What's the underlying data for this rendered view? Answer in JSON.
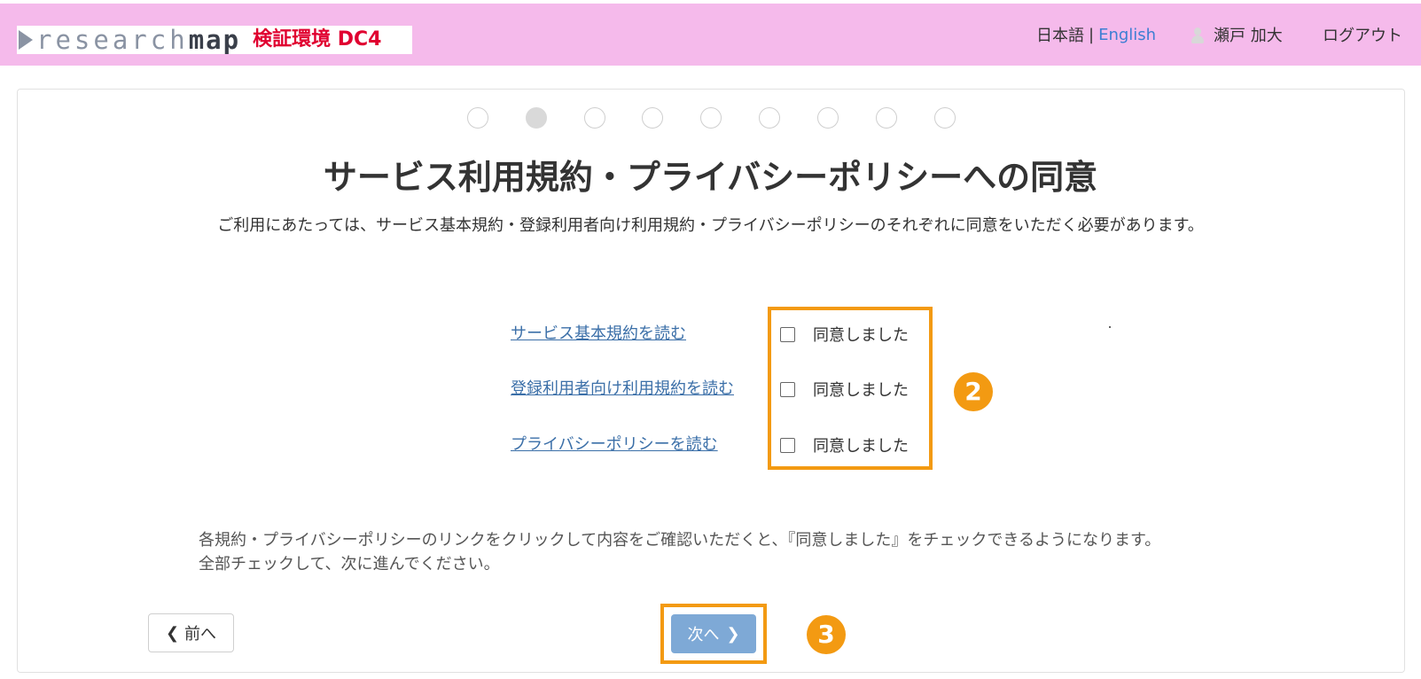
{
  "header": {
    "logo_text_light": "research",
    "logo_text_dark": "map",
    "environment_label": "検証環境 DC4",
    "lang_japanese": "日本語",
    "lang_separator": "|",
    "lang_english": "English",
    "user_icon": "user-icon",
    "user_name": "瀬戸 加大",
    "logout_label": "ログアウト",
    "background_color": "#f5baeb"
  },
  "steps": {
    "total": 9,
    "current": 2
  },
  "main": {
    "title": "サービス利用規約・プライバシーポリシーへの同意",
    "subtitle": "ご利用にあたっては、サービス基本規約・登録利用者向け利用規約・プライバシーポリシーのそれぞれに同意をいただく必要があります。"
  },
  "agreements": [
    {
      "link_label": "サービス基本規約を読む",
      "checkbox_label": "同意しました",
      "checked": false
    },
    {
      "link_label": "登録利用者向け利用規約を読む",
      "checkbox_label": "同意しました",
      "checked": false
    },
    {
      "link_label": "プライバシーポリシーを読む",
      "checkbox_label": "同意しました",
      "checked": false
    }
  ],
  "notice": {
    "line1": "各規約・プライバシーポリシーのリンクをクリックして内容をご確認いただくと、『同意しました』をチェックできるようになります。",
    "line2": "全部チェックして、次に進んでください。"
  },
  "navigation": {
    "prev_label": "前へ",
    "prev_icon": "chevron-left-icon",
    "next_label": "次へ",
    "next_icon": "chevron-right-icon",
    "next_color": "#7ea9d6"
  },
  "annotations": {
    "badge_2": "2",
    "badge_3": "3",
    "highlight_color": "#f39a12"
  }
}
